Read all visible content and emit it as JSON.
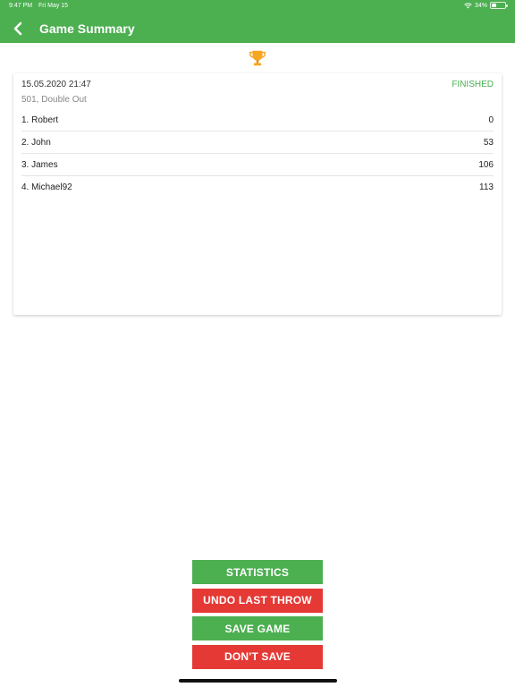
{
  "status_bar": {
    "time": "9:47 PM",
    "date": "Fri May 15",
    "battery": "34%"
  },
  "header": {
    "title": "Game Summary"
  },
  "game": {
    "datetime": "15.05.2020 21:47",
    "status": "FINISHED",
    "mode": "501, Double Out",
    "players": [
      {
        "name": "1. Robert",
        "score": "0"
      },
      {
        "name": "2. John",
        "score": "53"
      },
      {
        "name": "3. James",
        "score": "106"
      },
      {
        "name": "4. Michael92",
        "score": "113"
      }
    ]
  },
  "actions": {
    "statistics": "STATISTICS",
    "undo": "UNDO LAST THROW",
    "save": "SAVE GAME",
    "dont_save": "DON'T SAVE"
  },
  "colors": {
    "primary_green": "#4CAF50",
    "danger_red": "#E53935",
    "trophy_gold": "#F5A623"
  }
}
